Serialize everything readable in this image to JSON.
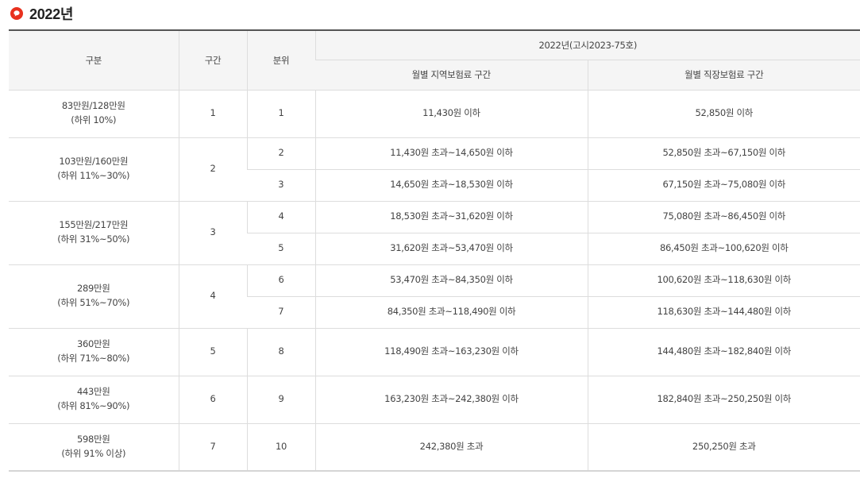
{
  "section": {
    "title": "2022년",
    "icon": "red-speech-bubble-icon",
    "accent_color": "#e8311e"
  },
  "table": {
    "header": {
      "category": "구분",
      "segment": "구간",
      "decile": "분위",
      "group_title": "2022년(고시2023-75호)",
      "regional": "월별 지역보험료 구간",
      "workplace": "월별 직장보험료 구간"
    },
    "groups": [
      {
        "label": "83만원/128만원",
        "sublabel": "(하위 10%)",
        "segment": "1",
        "rows": [
          {
            "decile": "1",
            "regional": "11,430원 이하",
            "workplace": "52,850원 이하"
          }
        ]
      },
      {
        "label": "103만원/160만원",
        "sublabel": "(하위 11%~30%)",
        "segment": "2",
        "rows": [
          {
            "decile": "2",
            "regional": "11,430원 초과~14,650원 이하",
            "workplace": "52,850원 초과~67,150원 이하"
          },
          {
            "decile": "3",
            "regional": "14,650원 초과~18,530원 이하",
            "workplace": "67,150원 초과~75,080원 이하"
          }
        ]
      },
      {
        "label": "155만원/217만원",
        "sublabel": "(하위 31%~50%)",
        "segment": "3",
        "rows": [
          {
            "decile": "4",
            "regional": "18,530원 초과~31,620원 이하",
            "workplace": "75,080원 초과~86,450원 이하"
          },
          {
            "decile": "5",
            "regional": "31,620원 초과~53,470원 이하",
            "workplace": "86,450원 초과~100,620원 이하"
          }
        ]
      },
      {
        "label": "289만원",
        "sublabel": "(하위 51%~70%)",
        "segment": "4",
        "rows": [
          {
            "decile": "6",
            "regional": "53,470원 초과~84,350원 이하",
            "workplace": "100,620원 초과~118,630원 이하"
          },
          {
            "decile": "7",
            "regional": "84,350원 초과~118,490원 이하",
            "workplace": "118,630원 초과~144,480원 이하"
          }
        ]
      },
      {
        "label": "360만원",
        "sublabel": "(하위 71%~80%)",
        "segment": "5",
        "rows": [
          {
            "decile": "8",
            "regional": "118,490원 초과~163,230원 이하",
            "workplace": "144,480원 초과~182,840원 이하"
          }
        ]
      },
      {
        "label": "443만원",
        "sublabel": "(하위 81%~90%)",
        "segment": "6",
        "rows": [
          {
            "decile": "9",
            "regional": "163,230원 초과~242,380원 이하",
            "workplace": "182,840원 초과~250,250원 이하"
          }
        ]
      },
      {
        "label": "598만원",
        "sublabel": "(하위 91% 이상)",
        "segment": "7",
        "rows": [
          {
            "decile": "10",
            "regional": "242,380원 초과",
            "workplace": "250,250원 초과"
          }
        ]
      }
    ]
  }
}
